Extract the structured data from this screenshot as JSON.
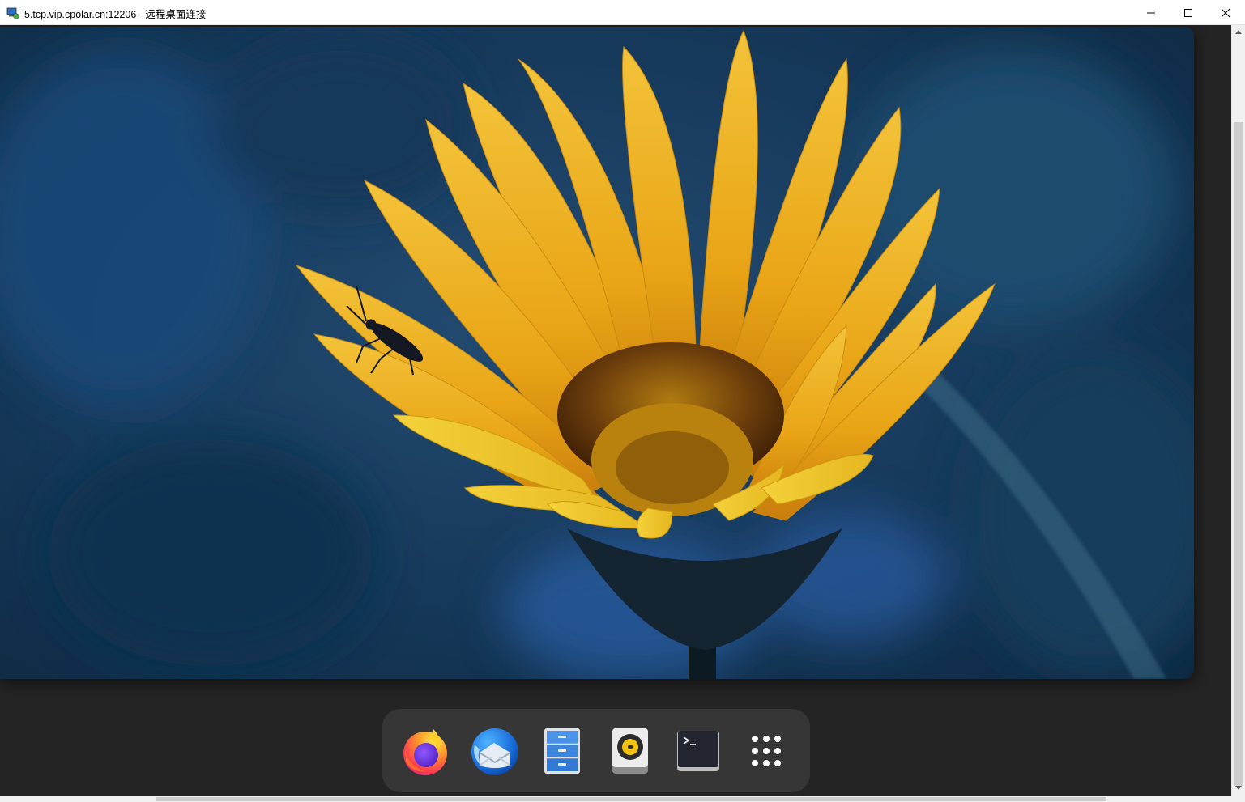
{
  "window": {
    "title": "5.tcp.vip.cpolar.cn:12206 - 远程桌面连接",
    "controls": {
      "minimize": "minimize-icon",
      "maximize": "maximize-icon",
      "close": "close-icon"
    }
  },
  "desktop": {
    "wallpaper": "yellow-gazania-flower-with-beetle",
    "colors": {
      "background": "#242424",
      "dock": "#363636",
      "petal": "#f0b21c",
      "bokeh": "#1b3f62"
    }
  },
  "dock": {
    "apps": [
      {
        "name": "Firefox",
        "icon": "firefox-icon"
      },
      {
        "name": "Thunderbird",
        "icon": "thunderbird-icon"
      },
      {
        "name": "Files",
        "icon": "file-cabinet-icon"
      },
      {
        "name": "Rhythmbox",
        "icon": "speaker-icon"
      },
      {
        "name": "Terminal",
        "icon": "terminal-icon"
      },
      {
        "name": "Show Applications",
        "icon": "app-grid-icon"
      }
    ]
  }
}
